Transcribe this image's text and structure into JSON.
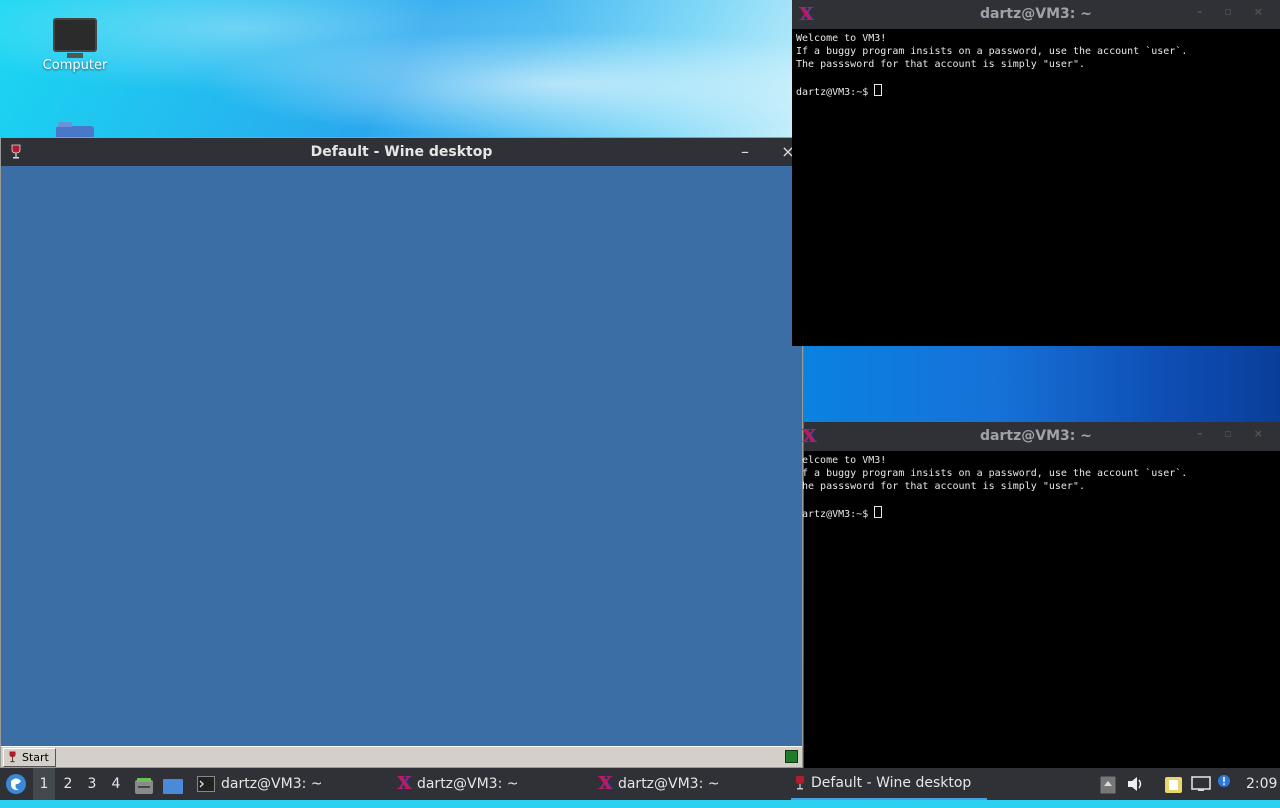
{
  "desktop": {
    "icons": [
      {
        "label": "Computer",
        "icon": "computer-monitor-icon"
      },
      {
        "label": "",
        "icon": "folder-icon"
      }
    ]
  },
  "wine_window": {
    "title": "Default - Wine desktop",
    "minimize": "–",
    "close": "×",
    "start_label": "Start",
    "desktop_color": "#3a6ea5"
  },
  "terminals": [
    {
      "title": "dartz@VM3: ~",
      "lines": [
        "Welcome to VM3!",
        "If a buggy program insists on a password, use the account `user`.",
        "The passsword for that account is simply \"user\".",
        "",
        "dartz@VM3:~$ "
      ]
    },
    {
      "title": "dartz@VM3: ~",
      "lines": [
        "elcome to VM3!",
        "f a buggy program insists on a password, use the account `user`.",
        "he passsword for that account is simply \"user\".",
        "",
        "artz@VM3:~$ "
      ]
    }
  ],
  "panel": {
    "workspaces": [
      "1",
      "2",
      "3",
      "4"
    ],
    "active_workspace": "1",
    "tasks": [
      {
        "label": "dartz@VM3: ~",
        "icon": "terminal-icon"
      },
      {
        "label": "dartz@VM3: ~",
        "icon": "xterm-icon"
      },
      {
        "label": "dartz@VM3: ~",
        "icon": "xterm-icon"
      },
      {
        "label": "Default - Wine desktop",
        "icon": "wine-icon",
        "active": true
      }
    ],
    "clock": "2:09"
  },
  "colors": {
    "panel_bg": "#2f3136",
    "accent": "#4a9de0",
    "terminal_bg": "#000000"
  }
}
